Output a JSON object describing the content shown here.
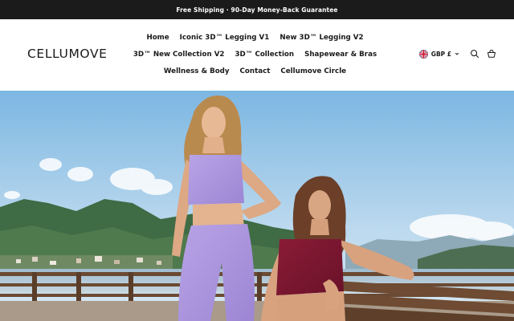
{
  "announcement": {
    "text": "Free Shipping · 90-Day Money-Back Guarantee"
  },
  "brand": {
    "logo_text": "CELLUMOVE"
  },
  "nav": {
    "rows": [
      [
        "Home",
        "Iconic 3D™ Legging V1",
        "New 3D™ Legging V2"
      ],
      [
        "3D™ New Collection V2",
        "3D™ Collection",
        "Shapewear & Bras"
      ],
      [
        "Wellness & Body",
        "Contact",
        "Cellumove Circle"
      ]
    ]
  },
  "currency": {
    "label": "GBP £",
    "flag_icon": "uk-flag-icon"
  },
  "icons": {
    "search": "search-icon",
    "cart": "cart-icon",
    "chevron": "chevron-down-icon"
  },
  "colors": {
    "announcement_bg": "#1b1b1b",
    "text": "#1a1a1a"
  }
}
